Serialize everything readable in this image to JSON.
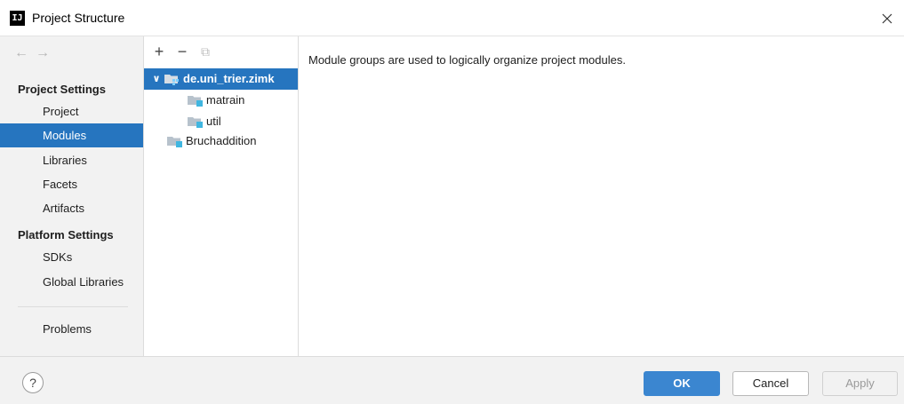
{
  "window": {
    "title": "Project Structure",
    "app_icon_text": "IJ"
  },
  "sidebar": {
    "back_icon": "←",
    "forward_icon": "→",
    "project_settings_header": "Project Settings",
    "project_items": [
      "Project",
      "Modules",
      "Libraries",
      "Facets",
      "Artifacts"
    ],
    "platform_settings_header": "Platform Settings",
    "platform_items": [
      "SDKs",
      "Global Libraries"
    ],
    "problems_label": "Problems",
    "selected_item": "Modules"
  },
  "tree": {
    "toolbar": {
      "add": "+",
      "remove": "−",
      "copy": "⧉"
    },
    "rows": [
      {
        "label": "de.uni_trier.zimk",
        "expanded": true,
        "selected": true,
        "kind": "module-group"
      },
      {
        "label": "matrain",
        "kind": "module"
      },
      {
        "label": "util",
        "kind": "module"
      },
      {
        "label": "Bruchaddition",
        "kind": "module"
      }
    ]
  },
  "content": {
    "description": "Module groups are used to logically organize project modules."
  },
  "footer": {
    "help_label": "?",
    "ok_label": "OK",
    "cancel_label": "Cancel",
    "apply_label": "Apply"
  },
  "colors": {
    "selection": "#2675bf",
    "ok_button": "#3b86d0",
    "sidebar_bg": "#f2f2f2",
    "module_folder": "#b7c2cc",
    "module_square": "#40b6e0"
  }
}
